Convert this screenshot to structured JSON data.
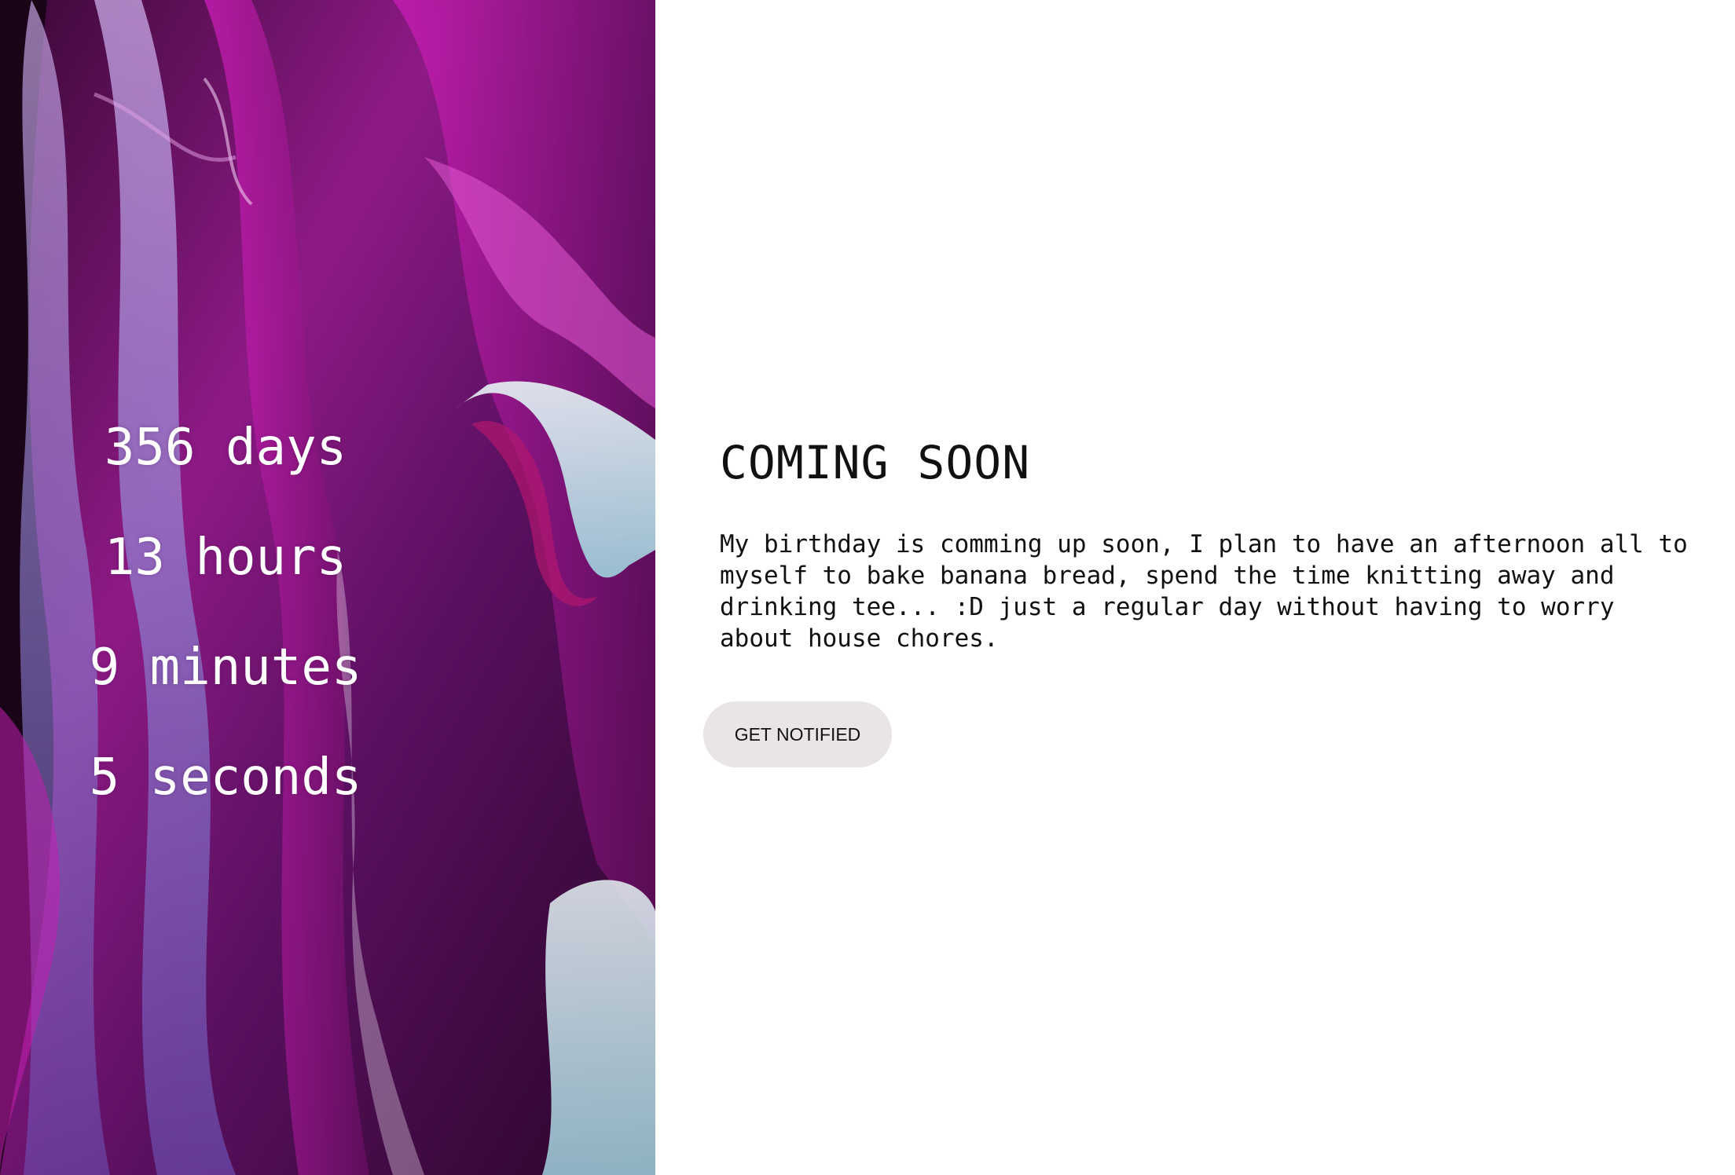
{
  "countdown": {
    "days": "356 days",
    "hours": "13 hours",
    "minutes": "9 minutes",
    "seconds": "5 seconds"
  },
  "main": {
    "heading": "COMING SOON",
    "description": "My birthday is comming up soon, I plan to have an afternoon all to myself to bake banana bread, spend the time knitting away and drinking tee... :D just a regular day without having to worry about house chores.",
    "button_label": "GET NOTIFIED"
  },
  "colors": {
    "accent_purple": "#a21a8f",
    "button_bg": "#e8e5e4",
    "text": "#111111"
  }
}
